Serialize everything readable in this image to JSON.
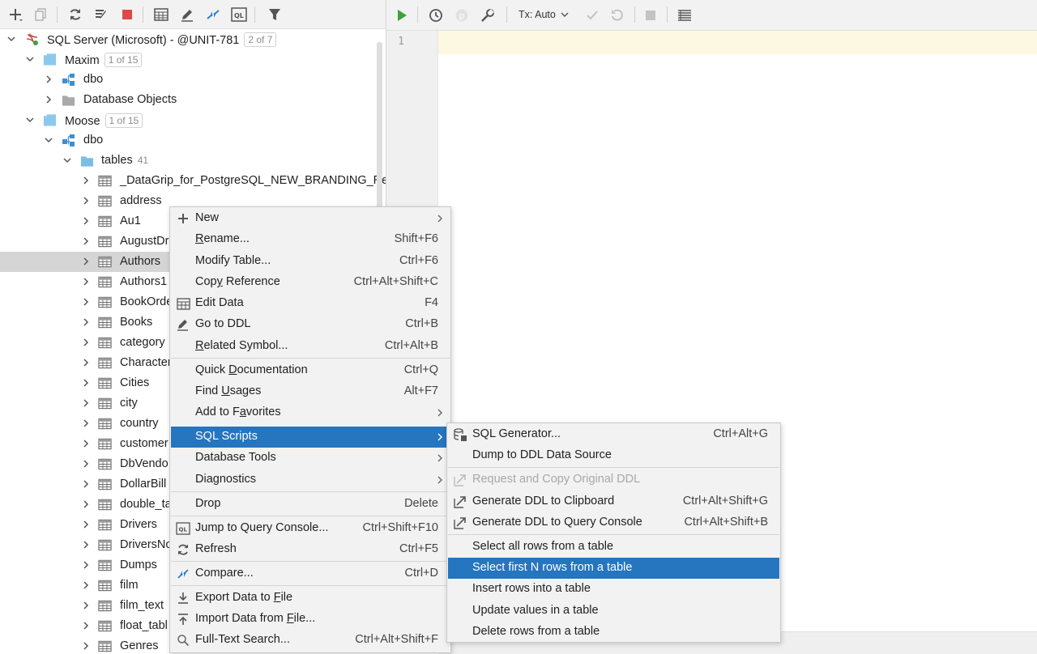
{
  "left_toolbar": {
    "buttons": [
      "add-icon",
      "duplicate-icon",
      "refresh-icon",
      "properties-icon",
      "stop-icon",
      "table-icon",
      "edit-icon",
      "compare-icon",
      "query-console-icon",
      "filter-icon"
    ]
  },
  "tree": {
    "root": {
      "label": "SQL Server (Microsoft) - @UNIT-781",
      "badge": "2 of 7"
    },
    "db1": {
      "label": "Maxim",
      "badge": "1 of 15"
    },
    "db1_schema": "dbo",
    "db1_objects": "Database Objects",
    "db2": {
      "label": "Moose",
      "badge": "1 of 15"
    },
    "db2_schema": "dbo",
    "tables_folder": {
      "label": "tables",
      "count": "41"
    },
    "tables": [
      "_DataGrip_for_PostgreSQL_NEW_BRANDING_Resp",
      "address",
      "Au1",
      "AugustDr",
      "Authors",
      "Authors1",
      "BookOrde",
      "Books",
      "category",
      "Character",
      "Cities",
      "city",
      "country",
      "customer",
      "DbVendo",
      "DollarBill",
      "double_ta",
      "Drivers",
      "DriversNo",
      "Dumps",
      "film",
      "film_text",
      "float_tabl",
      "Genres"
    ],
    "selected_table": "Authors"
  },
  "editor": {
    "toolbar": {
      "tx_mode": "Tx: Auto"
    },
    "line_number": "1"
  },
  "context_menu": {
    "items": [
      {
        "label": "New",
        "shortcut": ""
      },
      {
        "label": "Rename...",
        "shortcut": "Shift+F6"
      },
      {
        "label": "Modify Table...",
        "shortcut": "Ctrl+F6"
      },
      {
        "label": "Copy Reference",
        "shortcut": "Ctrl+Alt+Shift+C"
      },
      {
        "label": "Edit Data",
        "shortcut": "F4"
      },
      {
        "label": "Go to DDL",
        "shortcut": "Ctrl+B"
      },
      {
        "label": "Related Symbol...",
        "shortcut": "Ctrl+Alt+B"
      },
      {
        "label": "Quick Documentation",
        "shortcut": "Ctrl+Q"
      },
      {
        "label": "Find Usages",
        "shortcut": "Alt+F7"
      },
      {
        "label": "Add to Favorites",
        "shortcut": ""
      },
      {
        "label": "SQL Scripts",
        "shortcut": ""
      },
      {
        "label": "Database Tools",
        "shortcut": ""
      },
      {
        "label": "Diagnostics",
        "shortcut": ""
      },
      {
        "label": "Drop",
        "shortcut": "Delete"
      },
      {
        "label": "Jump to Query Console...",
        "shortcut": "Ctrl+Shift+F10"
      },
      {
        "label": "Refresh",
        "shortcut": "Ctrl+F5"
      },
      {
        "label": "Compare...",
        "shortcut": "Ctrl+D"
      },
      {
        "label": "Export Data to File",
        "shortcut": ""
      },
      {
        "label": "Import Data from File...",
        "shortcut": ""
      },
      {
        "label": "Full-Text Search...",
        "shortcut": "Ctrl+Alt+Shift+F"
      }
    ]
  },
  "submenu": {
    "items": [
      {
        "label": "SQL Generator...",
        "shortcut": "Ctrl+Alt+G"
      },
      {
        "label": "Dump to DDL Data Source",
        "shortcut": ""
      },
      {
        "label": "Request and Copy Original DDL",
        "shortcut": ""
      },
      {
        "label": "Generate DDL to Clipboard",
        "shortcut": "Ctrl+Alt+Shift+G"
      },
      {
        "label": "Generate DDL to Query Console",
        "shortcut": "Ctrl+Alt+Shift+B"
      },
      {
        "label": "Select all rows from a table",
        "shortcut": ""
      },
      {
        "label": "Select first N rows from a table",
        "shortcut": ""
      },
      {
        "label": "Insert rows into a table",
        "shortcut": ""
      },
      {
        "label": "Update values in a table",
        "shortcut": ""
      },
      {
        "label": "Delete rows from a table",
        "shortcut": ""
      }
    ]
  },
  "colors": {
    "accent": "#2675bf",
    "run": "#3ba33b",
    "stop": "#e04848",
    "folder": "#7bbde8",
    "current_line": "#fdf8e1"
  }
}
